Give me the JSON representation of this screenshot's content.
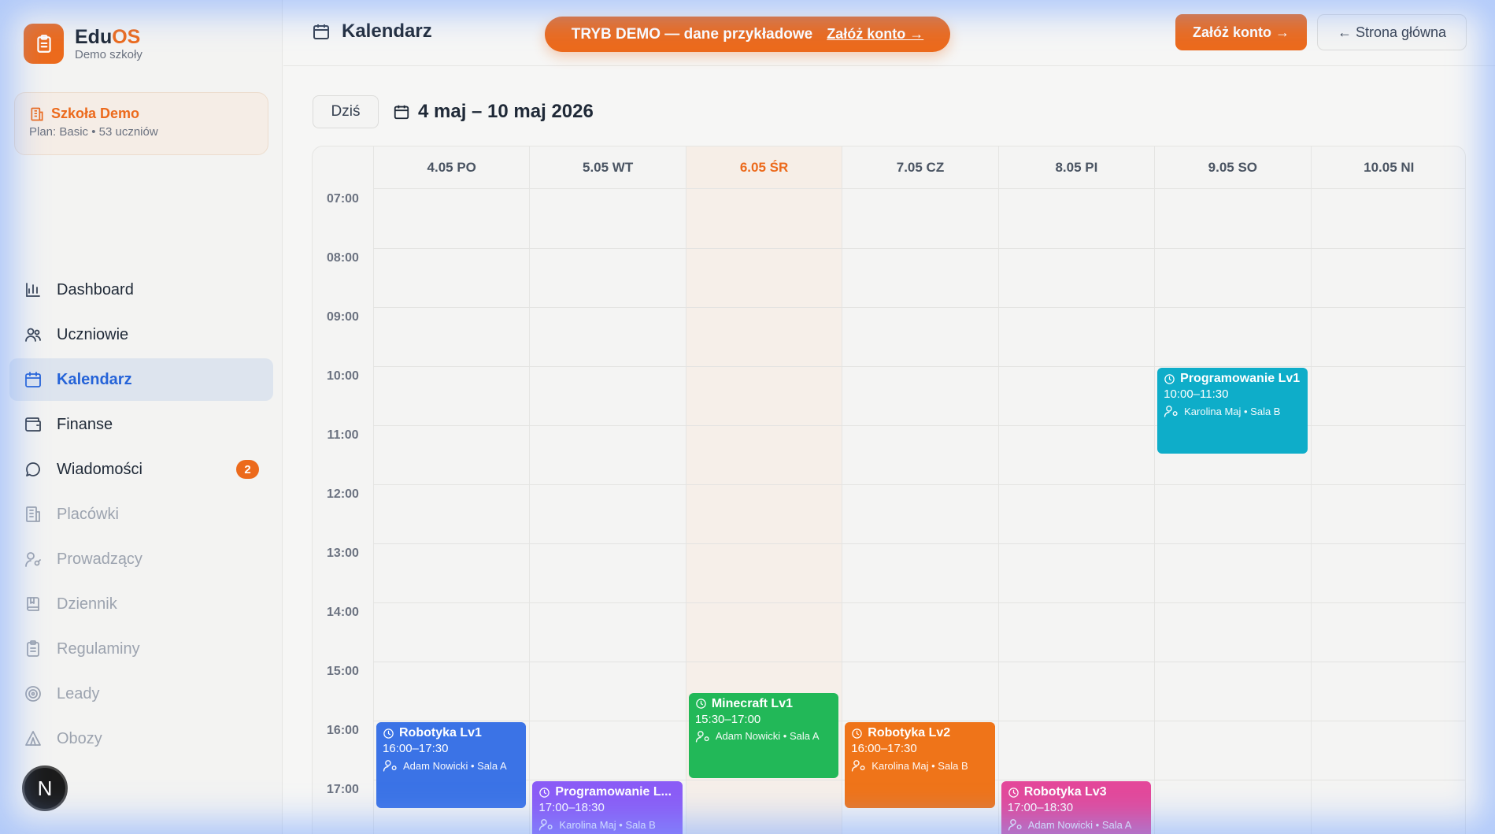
{
  "brand": {
    "name_main": "Edu",
    "name_accent": "OS",
    "subtitle": "Demo szkoły",
    "logo_icon": "clipboard-icon",
    "accent_color": "#ec6a1c"
  },
  "school": {
    "name": "Szkoła Demo",
    "plan": "Plan: Basic • 53 uczniów"
  },
  "nav": [
    {
      "label": "Dashboard",
      "icon": "chart-icon",
      "state": "normal"
    },
    {
      "label": "Uczniowie",
      "icon": "users-icon",
      "state": "normal"
    },
    {
      "label": "Kalendarz",
      "icon": "calendar-icon",
      "state": "active"
    },
    {
      "label": "Finanse",
      "icon": "wallet-icon",
      "state": "normal"
    },
    {
      "label": "Wiadomości",
      "icon": "message-icon",
      "state": "normal",
      "badge": "2"
    },
    {
      "label": "Placówki",
      "icon": "building-icon",
      "state": "disabled"
    },
    {
      "label": "Prowadzący",
      "icon": "user-key-icon",
      "state": "disabled"
    },
    {
      "label": "Dziennik",
      "icon": "book-icon",
      "state": "disabled"
    },
    {
      "label": "Regulaminy",
      "icon": "clipboard-icon",
      "state": "disabled"
    },
    {
      "label": "Leady",
      "icon": "target-icon",
      "state": "disabled"
    },
    {
      "label": "Obozy",
      "icon": "tent-icon",
      "state": "disabled"
    }
  ],
  "avatar": {
    "initial": "N"
  },
  "header": {
    "title": "Kalendarz",
    "demo_text": "TRYB DEMO — dane przykładowe",
    "demo_link": "Załóż konto →",
    "signup_button": "Załóż konto →",
    "home_button": "← Strona główna"
  },
  "toolbar": {
    "today_button": "Dziś",
    "range": "4 maj – 10 maj 2026"
  },
  "calendar": {
    "days": [
      {
        "label": "4.05 PO",
        "today": false
      },
      {
        "label": "5.05 WT",
        "today": false
      },
      {
        "label": "6.05 ŚR",
        "today": true
      },
      {
        "label": "7.05 CZ",
        "today": false
      },
      {
        "label": "8.05 PI",
        "today": false
      },
      {
        "label": "9.05 SO",
        "today": false
      },
      {
        "label": "10.05 NI",
        "today": false
      }
    ],
    "hours": [
      "07:00",
      "08:00",
      "09:00",
      "10:00",
      "11:00",
      "12:00",
      "13:00",
      "14:00",
      "15:00",
      "16:00",
      "17:00"
    ],
    "events": [
      {
        "title": "Robotyka Lv1",
        "time": "16:00–17:30",
        "teacher": "Adam Nowicki • Sala A",
        "day": 0,
        "start": 16.0,
        "end": 17.5,
        "color": "#3b73e6"
      },
      {
        "title": "Programowanie L...",
        "time": "17:00–18:30",
        "teacher": "Karolina Maj • Sala B",
        "day": 1,
        "start": 17.0,
        "end": 18.5,
        "color": "#8b5cf6"
      },
      {
        "title": "Minecraft Lv1",
        "time": "15:30–17:00",
        "teacher": "Adam Nowicki • Sala A",
        "day": 2,
        "start": 15.5,
        "end": 17.0,
        "color": "#22b858"
      },
      {
        "title": "Robotyka Lv2",
        "time": "16:00–17:30",
        "teacher": "Karolina Maj • Sala B",
        "day": 3,
        "start": 16.0,
        "end": 17.5,
        "color": "#ef7419"
      },
      {
        "title": "Robotyka Lv3",
        "time": "17:00–18:30",
        "teacher": "Adam Nowicki • Sala A",
        "day": 4,
        "start": 17.0,
        "end": 18.5,
        "color": "#e4489a"
      },
      {
        "title": "Programowanie Lv1",
        "time": "10:00–11:30",
        "teacher": "Karolina Maj • Sala B",
        "day": 5,
        "start": 10.0,
        "end": 11.5,
        "color": "#0eadc9"
      }
    ]
  }
}
